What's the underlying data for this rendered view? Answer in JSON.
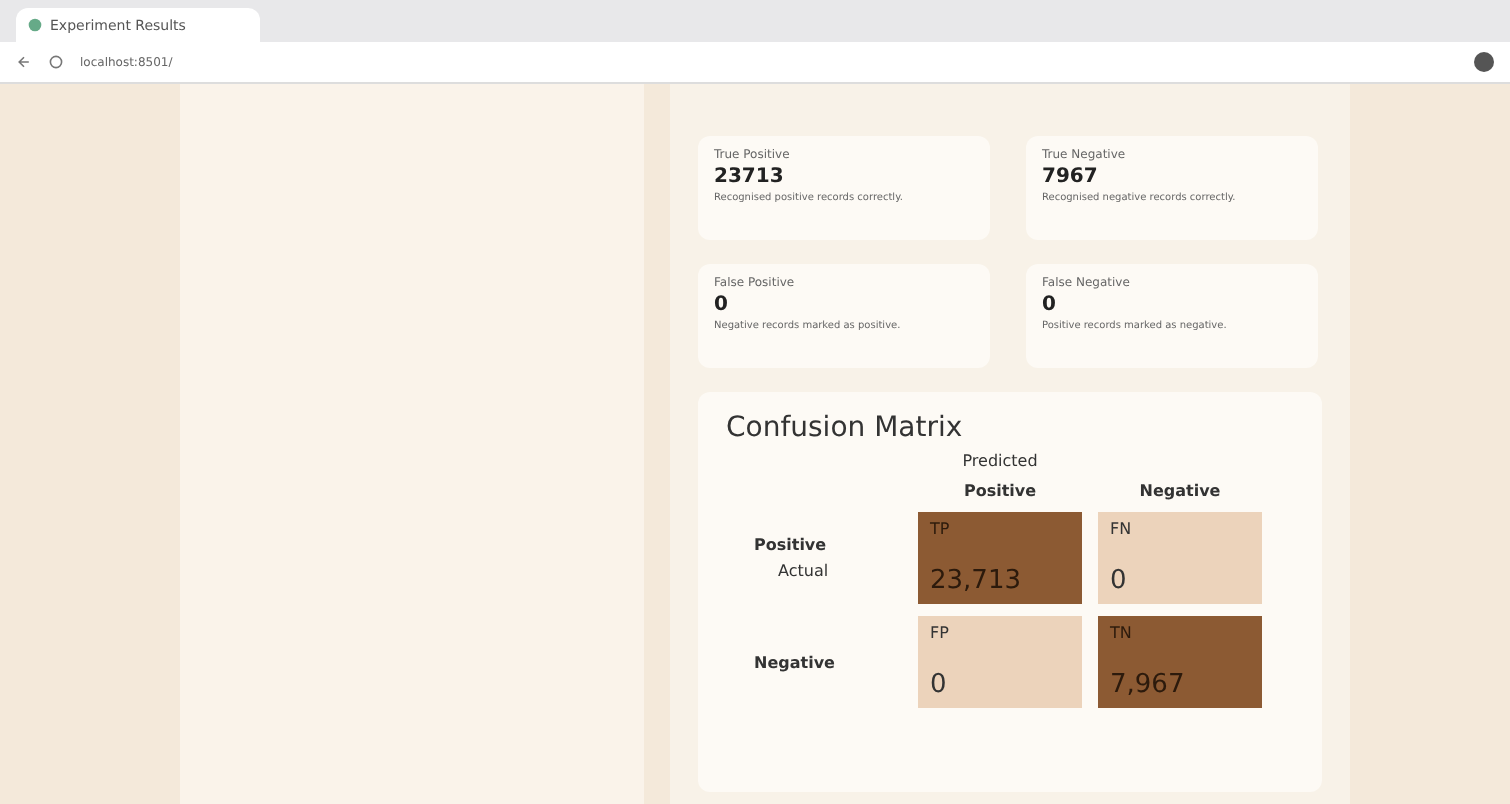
{
  "browser": {
    "tab_title": "Experiment Results",
    "url": "localhost:8501/"
  },
  "stats": [
    {
      "label": "True Positive",
      "value": "23713",
      "caption": "Recognised positive records correctly."
    },
    {
      "label": "True Negative",
      "value": "7967",
      "caption": "Recognised negative records correctly."
    },
    {
      "label": "False Positive",
      "value": "0",
      "caption": "Negative records marked as positive."
    },
    {
      "label": "False Negative",
      "value": "0",
      "caption": "Positive records marked as negative."
    }
  ],
  "confusion_matrix": {
    "title": "Confusion Matrix",
    "predicted_label": "Predicted",
    "actual_label": "Actual",
    "columns": [
      "Positive",
      "Negative"
    ],
    "rows": [
      "Positive",
      "Negative"
    ],
    "cells": [
      {
        "code": "TP",
        "value": "23,713",
        "color": "#8c5a33"
      },
      {
        "code": "FN",
        "value": "0",
        "color": "#ecd3bb"
      },
      {
        "code": "FP",
        "value": "0",
        "color": "#ecd3bb"
      },
      {
        "code": "TN",
        "value": "7,967",
        "color": "#8c5a33"
      }
    ]
  }
}
